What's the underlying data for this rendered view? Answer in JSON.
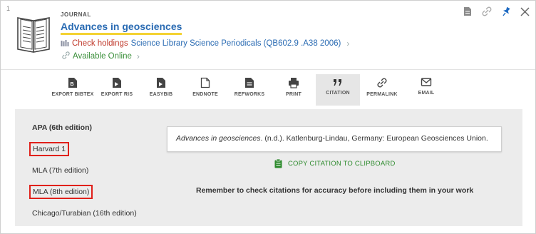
{
  "result": {
    "number": "1"
  },
  "record": {
    "type": "JOURNAL",
    "title": "Advances in geosciences",
    "holdings_status": "Check holdings",
    "holdings_location": "Science Library  Science Periodicals (QB602.9 .A38 2006)",
    "online_text": "Available Online"
  },
  "top_actions": [
    "document-icon",
    "link-icon",
    "pin-icon",
    "close-icon"
  ],
  "toolbar": {
    "items": [
      {
        "label": "EXPORT BIBTEX",
        "icon": "export-bibtex-icon"
      },
      {
        "label": "EXPORT RIS",
        "icon": "export-ris-icon"
      },
      {
        "label": "EASYBIB",
        "icon": "easybib-icon"
      },
      {
        "label": "ENDNOTE",
        "icon": "endnote-icon"
      },
      {
        "label": "REFWORKS",
        "icon": "refworks-icon"
      },
      {
        "label": "PRINT",
        "icon": "print-icon"
      },
      {
        "label": "CITATION",
        "icon": "quote-icon",
        "active": true
      },
      {
        "label": "PERMALINK",
        "icon": "permalink-icon"
      },
      {
        "label": "EMAIL",
        "icon": "email-icon"
      }
    ]
  },
  "citation": {
    "styles": [
      "APA (6th edition)",
      "Harvard 1",
      "MLA (7th edition)",
      "MLA (8th edition)",
      "Chicago/Turabian (16th edition)"
    ],
    "selected_style": "APA (6th edition)",
    "text_title": "Advances in geosciences",
    "text_rest": ". (n.d.). Katlenburg-Lindau, Germany: European Geosciences Union.",
    "copy_label": "COPY CITATION TO CLIPBOARD",
    "reminder": "Remember to check citations for accuracy before including them in your work"
  },
  "colors": {
    "title_link": "#2a6bb3",
    "title_underline": "#f4d233",
    "holdings_status": "#c0392b",
    "available": "#3a8f3a",
    "highlight_box": "#e0201a",
    "copy_green": "#2e8b2e",
    "pin_blue": "#1e6ac2"
  }
}
